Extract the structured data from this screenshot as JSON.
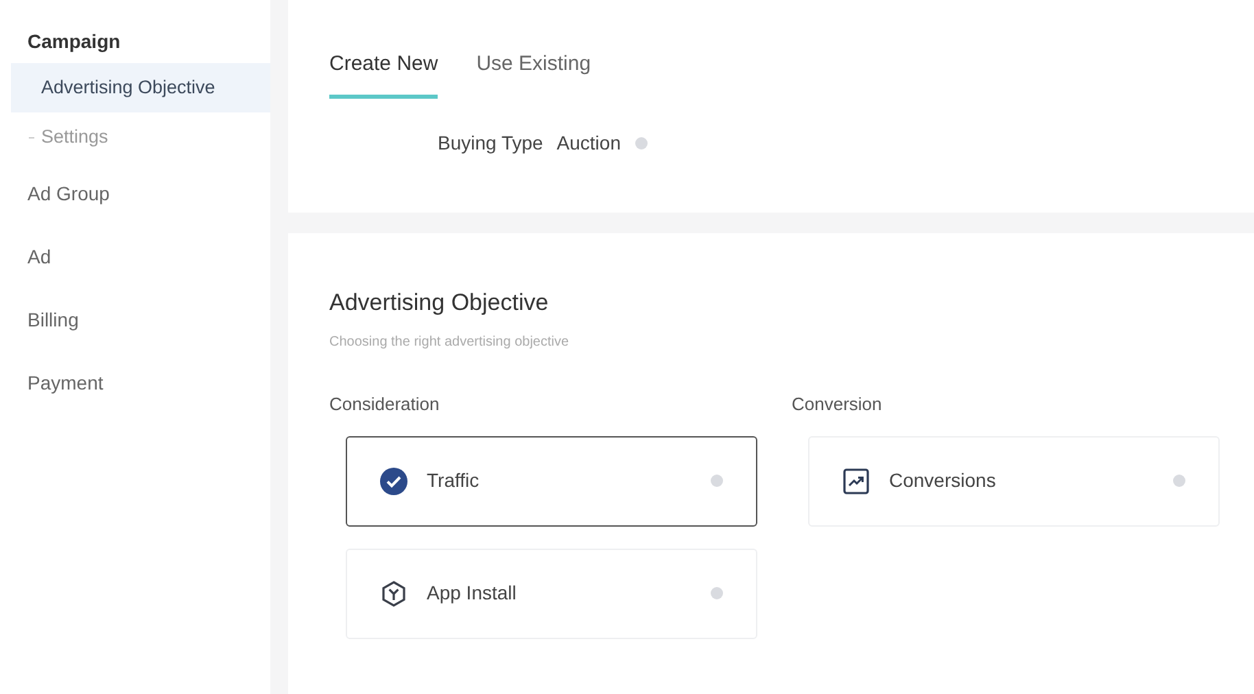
{
  "sidebar": {
    "sections": [
      {
        "label": "Campaign",
        "selected": false,
        "children": [
          {
            "label": "Advertising Objective",
            "selected": true
          },
          {
            "label": "Settings",
            "selected": false
          }
        ]
      },
      {
        "label": "Ad Group",
        "selected": false
      },
      {
        "label": "Ad",
        "selected": false
      },
      {
        "label": "Billing",
        "selected": false
      },
      {
        "label": "Payment",
        "selected": false
      }
    ]
  },
  "tabs": [
    {
      "label": "Create New",
      "selected": true
    },
    {
      "label": "Use Existing",
      "selected": false
    }
  ],
  "buying_type": {
    "label": "Buying Type",
    "value": "Auction"
  },
  "objective": {
    "title": "Advertising Objective",
    "subtitle": "Choosing the right advertising objective",
    "groups": [
      {
        "label": "Consideration",
        "options": [
          {
            "label": "Traffic",
            "kind": "check",
            "selected": true
          },
          {
            "label": "App Install",
            "kind": "app",
            "selected": false
          }
        ]
      },
      {
        "label": "Conversion",
        "options": [
          {
            "label": "Conversions",
            "kind": "chart",
            "selected": false
          }
        ]
      }
    ]
  }
}
